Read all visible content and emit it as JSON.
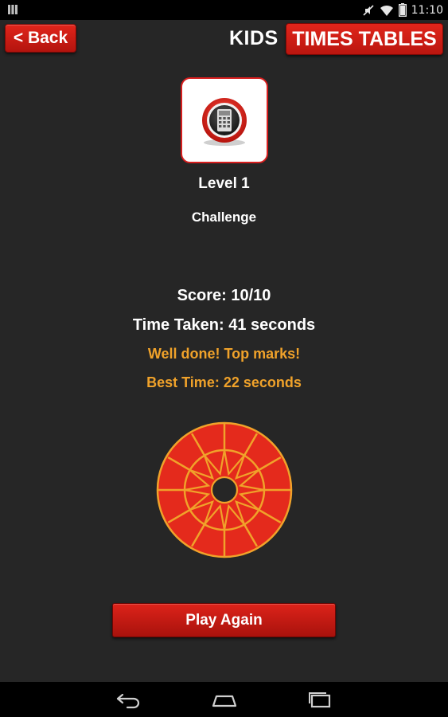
{
  "status_bar": {
    "time": "11:10",
    "icons": [
      "notification-icon",
      "no-sound-icon",
      "wifi-icon",
      "battery-icon"
    ]
  },
  "header": {
    "back_label": "< Back",
    "title_part1": "KIDS",
    "title_part2": "TIMES TABLES"
  },
  "app_icon": {
    "icon": "calculator-icon",
    "accent": "#d71e1e"
  },
  "level": {
    "title": "Level 1",
    "mode": "Challenge"
  },
  "results": {
    "score": "Score: 10/10",
    "time_taken": "Time Taken: 41 seconds",
    "message": "Well done! Top marks!",
    "best_time": "Best Time: 22 seconds"
  },
  "badge": {
    "icon": "star-badge-icon",
    "fill_color": "#e42a1c",
    "line_color": "#f0a22a"
  },
  "actions": {
    "play_again_label": "Play Again"
  },
  "nav": {
    "icons": [
      "back-nav-icon",
      "home-nav-icon",
      "recent-apps-icon"
    ]
  },
  "colors": {
    "background": "#262626",
    "accent_red": "#e1251b",
    "highlight_orange": "#f0a22a"
  }
}
